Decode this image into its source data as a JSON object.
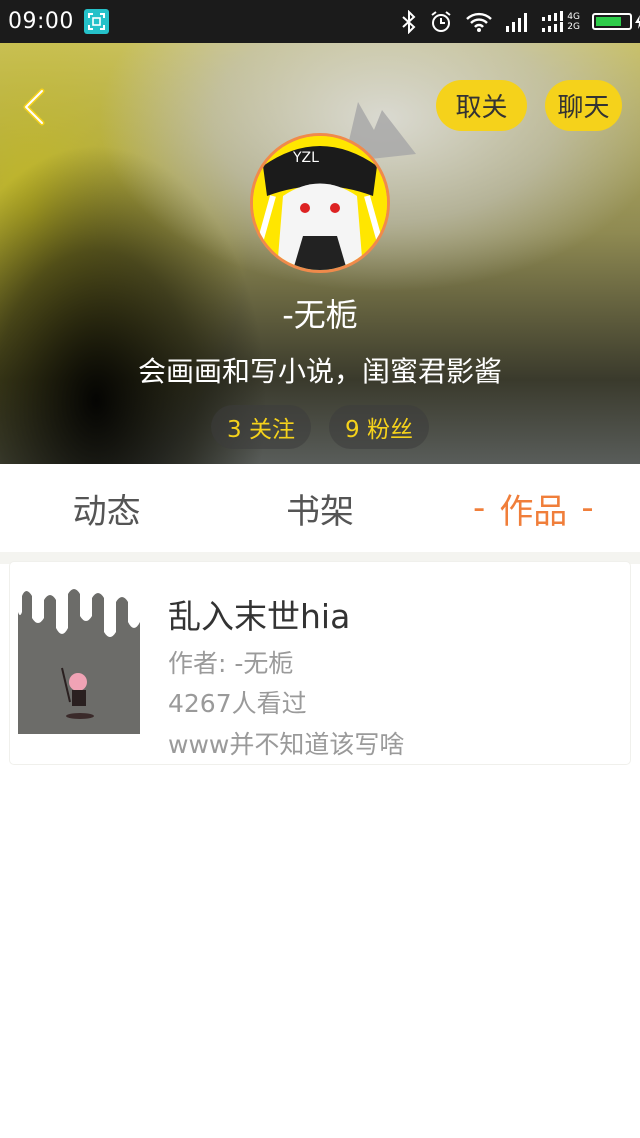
{
  "status_bar": {
    "time": "09:00",
    "network_labels": [
      "4G",
      "2G"
    ],
    "battery_color": "#2ecc4a"
  },
  "header": {
    "back_icon": "chevron-left-icon",
    "unfollow_label": "取关",
    "chat_label": "聊天",
    "nickname": "-无栀",
    "bio": "会画画和写小说，闺蜜君影酱",
    "following": "3 关注",
    "followers": "9 粉丝",
    "accent_color": "#f5d21b"
  },
  "tabs": [
    {
      "label": "动态",
      "active": false
    },
    {
      "label": "书架",
      "active": false
    },
    {
      "label": "作品",
      "active": true
    }
  ],
  "active_tab_dash": "-",
  "works": [
    {
      "title": "乱入末世hia",
      "author": "作者: -无栀",
      "views": "4267人看过",
      "description": "www并不知道该写啥"
    }
  ],
  "colors": {
    "active_tab": "#f07e3a",
    "avatar_ring": "#f08a4b"
  }
}
